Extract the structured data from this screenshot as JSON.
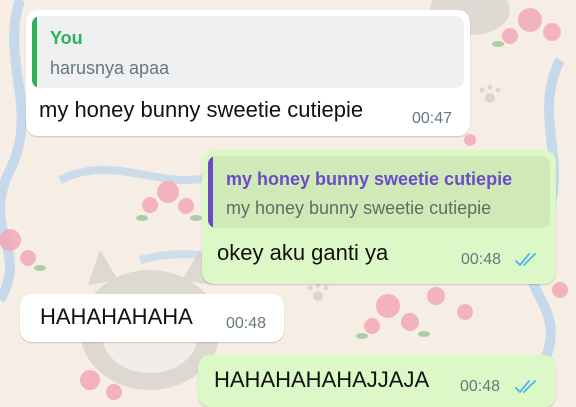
{
  "colors": {
    "incoming_bubble": "#ffffff",
    "outgoing_bubble": "#dcf8c6",
    "quote_you_accent": "#2fb05a",
    "quote_contact_accent": "#6c4bc9",
    "read_ticks": "#4fb6ec",
    "timestamp": "#667781"
  },
  "messages": [
    {
      "direction": "incoming",
      "reply": {
        "author": "You",
        "text": "harusnya apaa"
      },
      "text": "my honey bunny sweetie cutiepie",
      "time": "00:47"
    },
    {
      "direction": "outgoing",
      "reply": {
        "author": "my honey bunny sweetie cutiepie",
        "text": "my honey bunny sweetie cutiepie"
      },
      "text": "okey aku ganti ya",
      "time": "00:48",
      "status_icon": "double-check-read"
    },
    {
      "direction": "incoming",
      "text": "HAHAHAHAHA",
      "time": "00:48"
    },
    {
      "direction": "outgoing",
      "text": "HAHAHAHAHAJJAJA",
      "time": "00:48",
      "status_icon": "double-check-read"
    }
  ]
}
